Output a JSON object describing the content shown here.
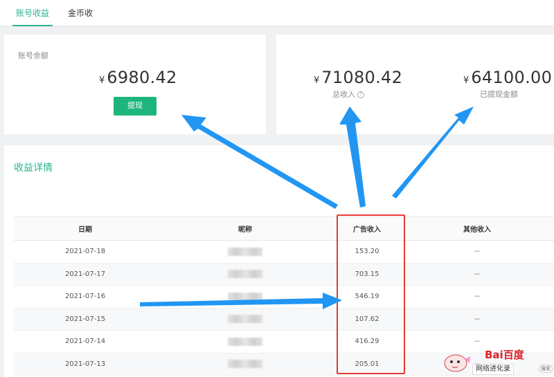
{
  "tabs": [
    {
      "label": "账号收益",
      "active": true
    },
    {
      "label": "金币收益",
      "active": false
    }
  ],
  "balance": {
    "label": "账号余额",
    "currency": "¥",
    "amount": "6980.42",
    "button_label": "提现"
  },
  "totals": {
    "total_income": {
      "currency": "¥",
      "amount": "71080.42",
      "label": "总收入"
    },
    "withdrawn": {
      "currency": "¥",
      "amount": "64100.00",
      "label": "已提现金额"
    }
  },
  "details": {
    "title": "收益详情",
    "columns": [
      "日期",
      "昵称",
      "广告收入",
      "其他收入"
    ],
    "rows": [
      {
        "date": "2021-07-18",
        "ad_income": "153.20",
        "other_income": "--"
      },
      {
        "date": "2021-07-17",
        "ad_income": "703.15",
        "other_income": "--"
      },
      {
        "date": "2021-07-16",
        "ad_income": "546.19",
        "other_income": "--"
      },
      {
        "date": "2021-07-15",
        "ad_income": "107.62",
        "other_income": "--"
      },
      {
        "date": "2021-07-14",
        "ad_income": "416.29",
        "other_income": "--"
      },
      {
        "date": "2021-07-13",
        "ad_income": "205.01",
        "other_income": "--"
      }
    ]
  },
  "watermark": {
    "logo": "Bai百度",
    "logo_du": "du",
    "text": "网络进化录",
    "search": "搜索"
  },
  "colors": {
    "accent": "#26b58f",
    "button": "#1db57c",
    "arrow": "#2196f3",
    "highlight": "#e53935"
  },
  "icons": [
    "help-icon",
    "mascot-icon",
    "search-icon"
  ]
}
